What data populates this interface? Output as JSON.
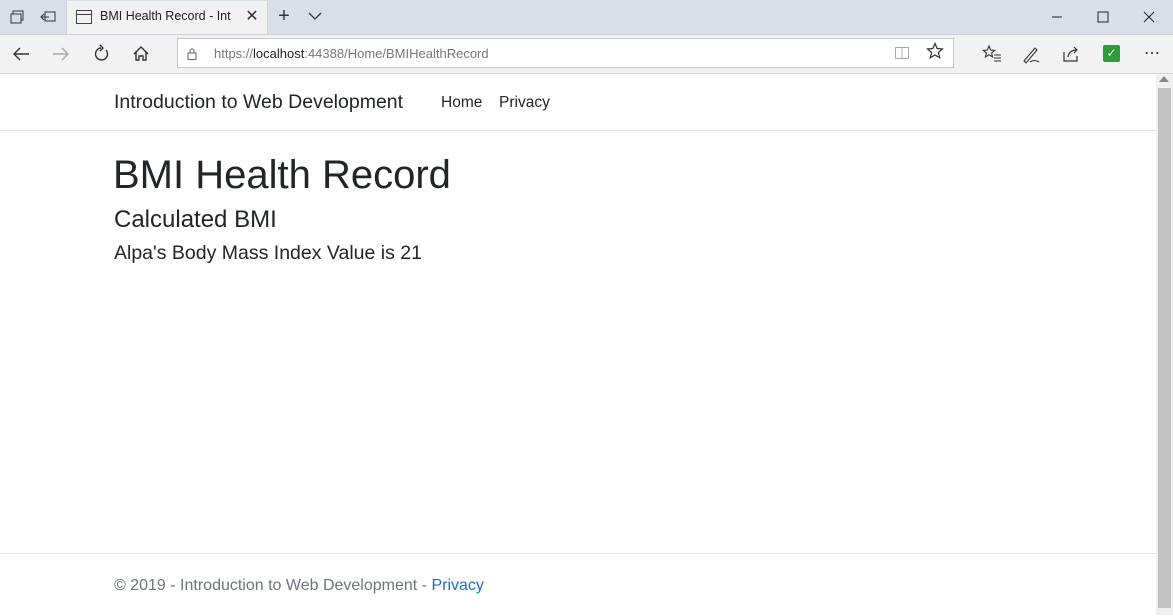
{
  "browser": {
    "tab_title": "BMI Health Record - Int",
    "close_tab_glyph": "✕",
    "new_tab_glyph": "+",
    "url_scheme": "https://",
    "url_host": "localhost",
    "url_rest": ":44388/Home/BMIHealthRecord",
    "icons": [
      "tab-actions-icon",
      "back-tabs-icon",
      "page-icon",
      "chevron-down-icon",
      "minimize-icon",
      "maximize-icon",
      "close-icon",
      "back-arrow-icon",
      "forward-arrow-icon",
      "refresh-icon",
      "home-icon",
      "lock-icon",
      "reading-view-icon",
      "star-icon",
      "favorites-icon",
      "pen-icon",
      "share-icon",
      "extension-check-icon",
      "more-icon"
    ],
    "accent_extension": "#2e9a3a"
  },
  "site": {
    "brand": "Introduction to Web Development",
    "nav": [
      "Home",
      "Privacy"
    ]
  },
  "main": {
    "title": "BMI Health Record",
    "subtitle": "Calculated BMI",
    "message": "Alpa's Body Mass Index Value is 21"
  },
  "footer": {
    "text": "© 2019 - Introduction to Web Development - ",
    "link": "Privacy",
    "link_color": "#1b6ec2"
  }
}
